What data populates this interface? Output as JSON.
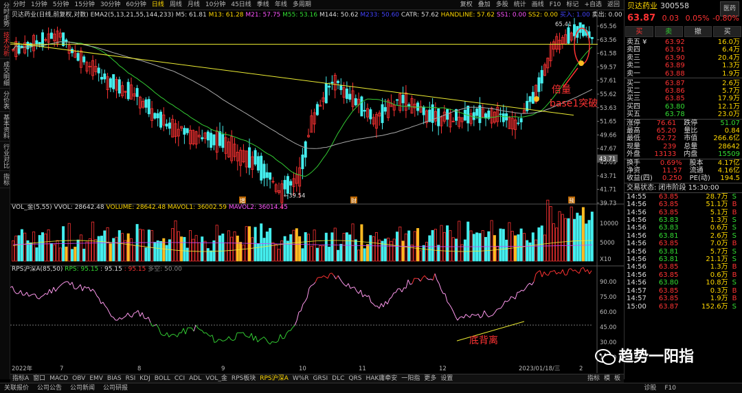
{
  "left_tabs": [
    "分时走势",
    "技术分析",
    "成交明细",
    "分价表",
    "基本资料",
    "行业对比",
    "指标"
  ],
  "top_periods": [
    "分时",
    "1分钟",
    "5分钟",
    "15分钟",
    "30分钟",
    "60分钟",
    "日线",
    "周线",
    "月线",
    "10分钟",
    "45日线",
    "季线",
    "年线",
    "多周期"
  ],
  "active_period": "日线",
  "top_right": [
    "复权",
    "叠加",
    "多股",
    "统计",
    "画线",
    "F10",
    "标记",
    "+自选",
    "返回"
  ],
  "stock_line": {
    "name": "贝达药业(日线,前复权,对数)",
    "ema": "EMA2(5,13,21,55,144,233)",
    "m5": "M5: 61.81",
    "m13": "M13: 61.28",
    "m21": "M21: 57.75",
    "m55": "M55: 53.16",
    "m144": "M144: 50.62",
    "m233": "M233: 50.60",
    "catr": "CATR: 57.62",
    "handline": "HANDLINE: 57.62",
    "ss1": "SS1: 0.00",
    "ss2": "SS2: 0.00",
    "buy": "买入: 1.00",
    "sell": "卖出: 0.00"
  },
  "price_axis": [
    "65.56",
    "63.56",
    "61.58",
    "59.57",
    "57.61",
    "55.62",
    "53.63",
    "51.65",
    "49.66",
    "47.67",
    "45.69",
    "43.71",
    "41.71",
    "39.73"
  ],
  "price_marker": "43.71",
  "hi_label": "65.41",
  "lo_label": "←39.54",
  "chart_tags": [
    "增",
    "财",
    "预"
  ],
  "vol_line": {
    "name": "VOL_金(5,55)",
    "vvol": "VVOL: 28642.48",
    "volume": "VOLUME: 28642.48",
    "mavol1": "MAVOL1: 36002.59",
    "mavol2": "MAVOL2: 36014.45"
  },
  "vol_axis": [
    "10000",
    "5000",
    "X10"
  ],
  "rps_line": {
    "name": "RPS沪深A(85,50)",
    "rps": "RPS: 95.15",
    "v2": ": 95.15",
    "v3": ": 95.15",
    "v4": "多空: 50.00"
  },
  "rps_axis": [
    "90.00",
    "75.00",
    "60.00",
    "45.00",
    "30.00",
    "15.00"
  ],
  "x_axis": [
    "2022年",
    "7",
    "8",
    "9",
    "10",
    "11",
    "12",
    "2023/01/18/三",
    "2"
  ],
  "annotations": {
    "a1": "倍量",
    "a2": "base1突破",
    "a3": "底背离"
  },
  "bottom_tabs": [
    "指标A",
    "窗口",
    "MACD",
    "OBV",
    "EMV",
    "BIAS",
    "RSI",
    "KDJ",
    "BOLL",
    "CCI",
    "ADL",
    "VOL_金",
    "RPS板块",
    "RPS沪深A",
    "W%R",
    "GRSI",
    "DLC",
    "QRS",
    "HAK庸牵安",
    "一阳指",
    "更多",
    "设置"
  ],
  "bottom_active": "RPS沪深A",
  "bottom_right": [
    "指标",
    "模",
    "板"
  ],
  "right": {
    "name": "贝达药业",
    "code": "300558",
    "tag": "医药",
    "price": "63.87",
    "chg": "0.03",
    "pct": "0.05%",
    "pct2": "-0.80%",
    "btn_buy": "买",
    "btn_sell": "卖",
    "btn_cancel": "撤",
    "btn_more": "买",
    "asks": [
      [
        "卖五 ¥",
        "63.92",
        "16.0万"
      ],
      [
        "卖四",
        "63.91",
        "6.4万"
      ],
      [
        "卖三",
        "63.90",
        "20.4万"
      ],
      [
        "卖二",
        "63.89",
        "1.3万"
      ],
      [
        "卖一",
        "63.88",
        "1.9万"
      ]
    ],
    "bids": [
      [
        "买一",
        "63.87",
        "2.6万"
      ],
      [
        "买二",
        "63.86",
        "5.7万"
      ],
      [
        "买三",
        "63.85",
        "17.9万"
      ],
      [
        "买四",
        "63.80",
        "12.1万"
      ],
      [
        "买五",
        "63.78",
        "23.0万"
      ]
    ],
    "stats": [
      [
        "涨停",
        "76.61",
        "跌停",
        "51.07"
      ],
      [
        "最高",
        "65.20",
        "量比",
        "0.84"
      ],
      [
        "最低",
        "62.72",
        "市值",
        "266.6亿"
      ],
      [
        "现量",
        "239",
        "总量",
        "28642"
      ],
      [
        "外盘",
        "13133",
        "内盘",
        "15509"
      ]
    ],
    "stats2": [
      [
        "换手",
        "0.69%",
        "股本",
        "4.17亿"
      ],
      [
        "净资",
        "11.57",
        "流通",
        "4.16亿"
      ],
      [
        "收益(四)",
        "0.250",
        "PE(动)",
        "194.5"
      ]
    ],
    "trade_status": "交易状态: 闭市阶段 15:30:00",
    "ticks": [
      [
        "14:55",
        "63.85",
        "28.7万",
        "S"
      ],
      [
        "14:56",
        "63.85",
        "51.1万",
        "B"
      ],
      [
        "14:56",
        "63.85",
        "5.1万",
        "B"
      ],
      [
        "14:56",
        "63.83",
        "1.3万",
        "S"
      ],
      [
        "14:56",
        "63.83",
        "0.6万",
        "S"
      ],
      [
        "14:56",
        "63.81",
        "2.6万",
        "S"
      ],
      [
        "14:56",
        "63.85",
        "7.0万",
        "B"
      ],
      [
        "14:56",
        "63.81",
        "5.7万",
        "S"
      ],
      [
        "14:56",
        "63.81",
        "21.1万",
        "S"
      ],
      [
        "14:56",
        "63.85",
        "1.3万",
        "B"
      ],
      [
        "14:56",
        "63.85",
        "0.6万",
        "B"
      ],
      [
        "14:56",
        "63.80",
        "10.8万",
        "S"
      ],
      [
        "14:57",
        "63.85",
        "0.3万",
        "B"
      ],
      [
        "14:57",
        "63.85",
        "1.9万",
        "B"
      ],
      [
        "15:00",
        "63.87",
        "152.6万",
        "S"
      ]
    ]
  },
  "status_bar": [
    "关联报价",
    "公司公告",
    "公司新闻",
    "公司研报"
  ],
  "status_right": [
    "诊股",
    "F10"
  ],
  "watermark": "趋势一阳指",
  "chart_data": {
    "type": "candlestick",
    "x": [
      "2022-06",
      "2022-07",
      "2022-08",
      "2022-09",
      "2022-10",
      "2022-11",
      "2022-12",
      "2023-01-18",
      "2023-02"
    ],
    "close": [
      62,
      60,
      52,
      46,
      40,
      56,
      53,
      50,
      62,
      64
    ],
    "ylim": [
      39.54,
      65.41
    ],
    "log_scale": true,
    "rps": [
      80,
      85,
      55,
      40,
      37,
      85,
      75,
      62,
      92,
      95
    ],
    "rps_ylim": [
      15,
      95
    ]
  }
}
